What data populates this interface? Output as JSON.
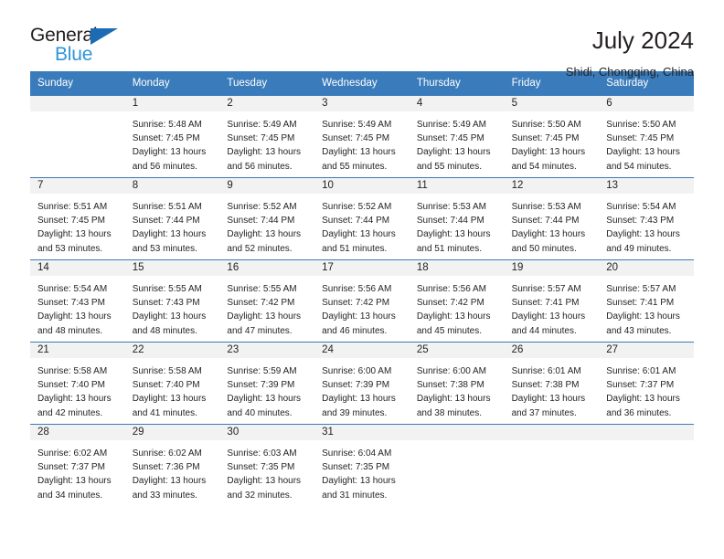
{
  "brand": {
    "name_part1": "General",
    "name_part2": "Blue",
    "accent_color": "#2e95d8",
    "triangle_color": "#1b6cb5",
    "triangle_icon": "triangle-icon"
  },
  "header": {
    "title": "July 2024",
    "subtitle": "Shidi, Chongqing, China"
  },
  "calendar": {
    "header_color": "#3a7cbb",
    "weekdays": [
      "Sunday",
      "Monday",
      "Tuesday",
      "Wednesday",
      "Thursday",
      "Friday",
      "Saturday"
    ],
    "weeks": [
      [
        {
          "day": "",
          "sunrise": "",
          "sunset": "",
          "daylight1": "",
          "daylight2": ""
        },
        {
          "day": "1",
          "sunrise": "Sunrise: 5:48 AM",
          "sunset": "Sunset: 7:45 PM",
          "daylight1": "Daylight: 13 hours",
          "daylight2": "and 56 minutes."
        },
        {
          "day": "2",
          "sunrise": "Sunrise: 5:49 AM",
          "sunset": "Sunset: 7:45 PM",
          "daylight1": "Daylight: 13 hours",
          "daylight2": "and 56 minutes."
        },
        {
          "day": "3",
          "sunrise": "Sunrise: 5:49 AM",
          "sunset": "Sunset: 7:45 PM",
          "daylight1": "Daylight: 13 hours",
          "daylight2": "and 55 minutes."
        },
        {
          "day": "4",
          "sunrise": "Sunrise: 5:49 AM",
          "sunset": "Sunset: 7:45 PM",
          "daylight1": "Daylight: 13 hours",
          "daylight2": "and 55 minutes."
        },
        {
          "day": "5",
          "sunrise": "Sunrise: 5:50 AM",
          "sunset": "Sunset: 7:45 PM",
          "daylight1": "Daylight: 13 hours",
          "daylight2": "and 54 minutes."
        },
        {
          "day": "6",
          "sunrise": "Sunrise: 5:50 AM",
          "sunset": "Sunset: 7:45 PM",
          "daylight1": "Daylight: 13 hours",
          "daylight2": "and 54 minutes."
        }
      ],
      [
        {
          "day": "7",
          "sunrise": "Sunrise: 5:51 AM",
          "sunset": "Sunset: 7:45 PM",
          "daylight1": "Daylight: 13 hours",
          "daylight2": "and 53 minutes."
        },
        {
          "day": "8",
          "sunrise": "Sunrise: 5:51 AM",
          "sunset": "Sunset: 7:44 PM",
          "daylight1": "Daylight: 13 hours",
          "daylight2": "and 53 minutes."
        },
        {
          "day": "9",
          "sunrise": "Sunrise: 5:52 AM",
          "sunset": "Sunset: 7:44 PM",
          "daylight1": "Daylight: 13 hours",
          "daylight2": "and 52 minutes."
        },
        {
          "day": "10",
          "sunrise": "Sunrise: 5:52 AM",
          "sunset": "Sunset: 7:44 PM",
          "daylight1": "Daylight: 13 hours",
          "daylight2": "and 51 minutes."
        },
        {
          "day": "11",
          "sunrise": "Sunrise: 5:53 AM",
          "sunset": "Sunset: 7:44 PM",
          "daylight1": "Daylight: 13 hours",
          "daylight2": "and 51 minutes."
        },
        {
          "day": "12",
          "sunrise": "Sunrise: 5:53 AM",
          "sunset": "Sunset: 7:44 PM",
          "daylight1": "Daylight: 13 hours",
          "daylight2": "and 50 minutes."
        },
        {
          "day": "13",
          "sunrise": "Sunrise: 5:54 AM",
          "sunset": "Sunset: 7:43 PM",
          "daylight1": "Daylight: 13 hours",
          "daylight2": "and 49 minutes."
        }
      ],
      [
        {
          "day": "14",
          "sunrise": "Sunrise: 5:54 AM",
          "sunset": "Sunset: 7:43 PM",
          "daylight1": "Daylight: 13 hours",
          "daylight2": "and 48 minutes."
        },
        {
          "day": "15",
          "sunrise": "Sunrise: 5:55 AM",
          "sunset": "Sunset: 7:43 PM",
          "daylight1": "Daylight: 13 hours",
          "daylight2": "and 48 minutes."
        },
        {
          "day": "16",
          "sunrise": "Sunrise: 5:55 AM",
          "sunset": "Sunset: 7:42 PM",
          "daylight1": "Daylight: 13 hours",
          "daylight2": "and 47 minutes."
        },
        {
          "day": "17",
          "sunrise": "Sunrise: 5:56 AM",
          "sunset": "Sunset: 7:42 PM",
          "daylight1": "Daylight: 13 hours",
          "daylight2": "and 46 minutes."
        },
        {
          "day": "18",
          "sunrise": "Sunrise: 5:56 AM",
          "sunset": "Sunset: 7:42 PM",
          "daylight1": "Daylight: 13 hours",
          "daylight2": "and 45 minutes."
        },
        {
          "day": "19",
          "sunrise": "Sunrise: 5:57 AM",
          "sunset": "Sunset: 7:41 PM",
          "daylight1": "Daylight: 13 hours",
          "daylight2": "and 44 minutes."
        },
        {
          "day": "20",
          "sunrise": "Sunrise: 5:57 AM",
          "sunset": "Sunset: 7:41 PM",
          "daylight1": "Daylight: 13 hours",
          "daylight2": "and 43 minutes."
        }
      ],
      [
        {
          "day": "21",
          "sunrise": "Sunrise: 5:58 AM",
          "sunset": "Sunset: 7:40 PM",
          "daylight1": "Daylight: 13 hours",
          "daylight2": "and 42 minutes."
        },
        {
          "day": "22",
          "sunrise": "Sunrise: 5:58 AM",
          "sunset": "Sunset: 7:40 PM",
          "daylight1": "Daylight: 13 hours",
          "daylight2": "and 41 minutes."
        },
        {
          "day": "23",
          "sunrise": "Sunrise: 5:59 AM",
          "sunset": "Sunset: 7:39 PM",
          "daylight1": "Daylight: 13 hours",
          "daylight2": "and 40 minutes."
        },
        {
          "day": "24",
          "sunrise": "Sunrise: 6:00 AM",
          "sunset": "Sunset: 7:39 PM",
          "daylight1": "Daylight: 13 hours",
          "daylight2": "and 39 minutes."
        },
        {
          "day": "25",
          "sunrise": "Sunrise: 6:00 AM",
          "sunset": "Sunset: 7:38 PM",
          "daylight1": "Daylight: 13 hours",
          "daylight2": "and 38 minutes."
        },
        {
          "day": "26",
          "sunrise": "Sunrise: 6:01 AM",
          "sunset": "Sunset: 7:38 PM",
          "daylight1": "Daylight: 13 hours",
          "daylight2": "and 37 minutes."
        },
        {
          "day": "27",
          "sunrise": "Sunrise: 6:01 AM",
          "sunset": "Sunset: 7:37 PM",
          "daylight1": "Daylight: 13 hours",
          "daylight2": "and 36 minutes."
        }
      ],
      [
        {
          "day": "28",
          "sunrise": "Sunrise: 6:02 AM",
          "sunset": "Sunset: 7:37 PM",
          "daylight1": "Daylight: 13 hours",
          "daylight2": "and 34 minutes."
        },
        {
          "day": "29",
          "sunrise": "Sunrise: 6:02 AM",
          "sunset": "Sunset: 7:36 PM",
          "daylight1": "Daylight: 13 hours",
          "daylight2": "and 33 minutes."
        },
        {
          "day": "30",
          "sunrise": "Sunrise: 6:03 AM",
          "sunset": "Sunset: 7:35 PM",
          "daylight1": "Daylight: 13 hours",
          "daylight2": "and 32 minutes."
        },
        {
          "day": "31",
          "sunrise": "Sunrise: 6:04 AM",
          "sunset": "Sunset: 7:35 PM",
          "daylight1": "Daylight: 13 hours",
          "daylight2": "and 31 minutes."
        },
        {
          "day": "",
          "sunrise": "",
          "sunset": "",
          "daylight1": "",
          "daylight2": ""
        },
        {
          "day": "",
          "sunrise": "",
          "sunset": "",
          "daylight1": "",
          "daylight2": ""
        },
        {
          "day": "",
          "sunrise": "",
          "sunset": "",
          "daylight1": "",
          "daylight2": ""
        }
      ]
    ]
  }
}
